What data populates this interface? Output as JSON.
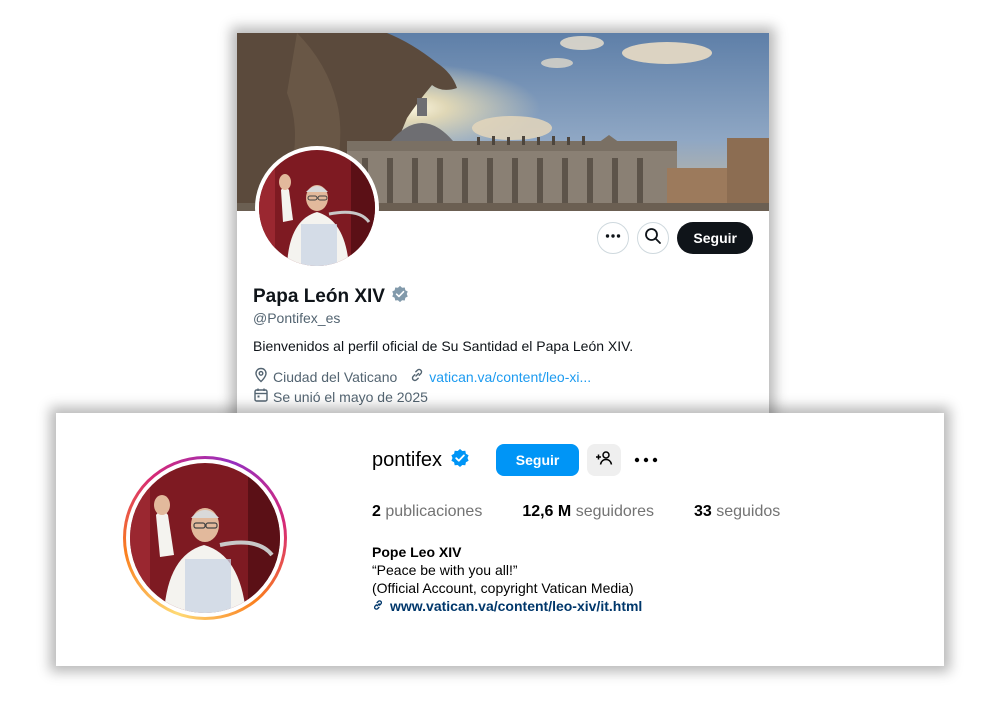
{
  "x_profile": {
    "display_name": "Papa León XIV",
    "verified_icon": "verified-badge-gray",
    "handle": "@Pontifex_es",
    "bio": "Bienvenidos al perfil oficial de Su Santidad el Papa León XIV.",
    "location": "Ciudad del Vaticano",
    "website": "vatican.va/content/leo-xi...",
    "joined": "Se unió el mayo de 2025",
    "follow_label": "Seguir",
    "icons": {
      "more": "more-horizontal-icon",
      "search": "search-icon",
      "location": "location-pin-icon",
      "link": "link-icon",
      "calendar": "calendar-icon"
    },
    "colors": {
      "follow_button": "#0f1419",
      "link": "#1d9bf0",
      "secondary_text": "#536471"
    }
  },
  "instagram_profile": {
    "username": "pontifex",
    "verified_icon": "verified-badge-blue",
    "follow_label": "Seguir",
    "stats": [
      {
        "count": "2",
        "label": "publicaciones"
      },
      {
        "count": "12,6 M",
        "label": "seguidores"
      },
      {
        "count": "33",
        "label": "seguidos"
      }
    ],
    "bio_name": "Pope Leo XIV",
    "bio_line1": "“Peace be with you all!”",
    "bio_line2": "(Official Account, copyright Vatican Media)",
    "bio_link": "www.vatican.va/content/leo-xiv/it.html",
    "icons": {
      "suggest": "add-person-icon",
      "more": "more-horizontal-icon",
      "link": "link-icon"
    },
    "colors": {
      "follow_button": "#0095f6",
      "link": "#00376b",
      "verified": "#0095f6"
    }
  }
}
